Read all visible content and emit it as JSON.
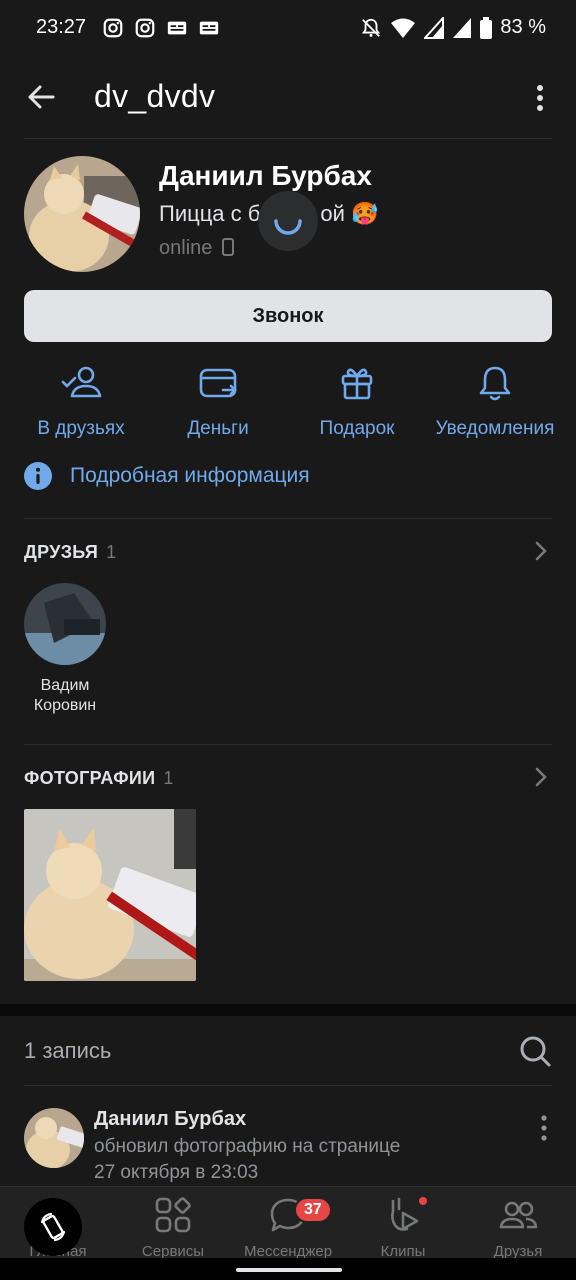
{
  "status_bar": {
    "time": "23:27",
    "battery": "83 %"
  },
  "header": {
    "title": "dv_dvdv"
  },
  "profile": {
    "name": "Даниил Бурбах",
    "status_text": "Пицца с б",
    "status_text_tail": "ой",
    "status_emoji": "🥵",
    "online": "online"
  },
  "call_button": "Звонок",
  "actions": [
    {
      "label": "В друзьях",
      "icon": "user-check-icon"
    },
    {
      "label": "Деньги",
      "icon": "card-transfer-icon"
    },
    {
      "label": "Подарок",
      "icon": "gift-icon"
    },
    {
      "label": "Уведомления",
      "icon": "bell-icon"
    }
  ],
  "details_link": "Подробная информация",
  "friends": {
    "title": "ДРУЗЬЯ",
    "count": "1",
    "items": [
      {
        "name": "Вадим Коровин"
      }
    ]
  },
  "photos": {
    "title": "ФОТОГРАФИИ",
    "count": "1"
  },
  "posts": {
    "count_label": "1 запись"
  },
  "post": {
    "author": "Даниил Бурбах",
    "action": "обновил фотографию на странице",
    "date": "27 октября в 23:03"
  },
  "bottom_nav": [
    {
      "label": "Главная",
      "icon": "home-icon"
    },
    {
      "label": "Сервисы",
      "icon": "services-icon"
    },
    {
      "label": "Мессенджер",
      "icon": "messenger-icon",
      "badge": "37"
    },
    {
      "label": "Клипы",
      "icon": "clips-icon"
    },
    {
      "label": "Друзья",
      "icon": "friends-icon"
    }
  ],
  "colors": {
    "accent": "#71aaeb",
    "background": "#19191a",
    "badge": "#e64646"
  }
}
